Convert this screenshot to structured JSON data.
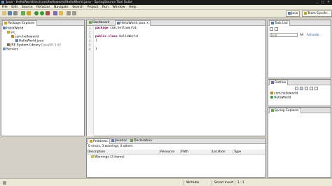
{
  "window": {
    "title": "Java - HelloWorld/src/com/helloworld/HelloWorld.java - SpringSource Tool Suite",
    "controls": [
      "_",
      "□",
      "✕"
    ]
  },
  "menu": [
    "File",
    "Edit",
    "Source",
    "Refactor",
    "Navigate",
    "Search",
    "Project",
    "Run",
    "Window",
    "Help"
  ],
  "perspectives": {
    "java": "Java",
    "team": "Team Synchr..."
  },
  "package_explorer": {
    "tab": "Package Explorer",
    "tree": [
      "HelloWorld",
      "src",
      "com.helloworld",
      "HelloWorld.java",
      "JRE System Library",
      "[JavaSE-1.6]",
      "Servers"
    ]
  },
  "editor": {
    "tabs": [
      "Dashboard",
      "HelloWorld.java"
    ],
    "line_numbers": [
      "1",
      "2",
      "3",
      "4",
      "5",
      "6"
    ],
    "lines": [
      {
        "kw": "package",
        "rest": " com.helloworld;"
      },
      {
        "kw": "",
        "rest": ""
      },
      {
        "kw": "public class",
        "rest": " HelloWorld"
      },
      {
        "kw": "",
        "rest": "{"
      },
      {
        "kw": "",
        "rest": ""
      },
      {
        "kw": "",
        "rest": "}"
      }
    ]
  },
  "task_list": {
    "tab": "Task List",
    "find_label": "Find",
    "all_label": "All",
    "activate_label": "Activate..."
  },
  "outline": {
    "tab": "Outline",
    "items": [
      "com.helloworld",
      "HelloWorld"
    ]
  },
  "spring_explorer": {
    "tab": "Spring Explorer"
  },
  "problems": {
    "tabs": [
      "Problems",
      "Javadoc",
      "Declaration"
    ],
    "summary": "0 errors, 3 warnings, 0 others",
    "columns": [
      "Description",
      "Resource",
      "Path",
      "Location",
      "Type"
    ],
    "rows": [
      {
        "description": "Warnings (3 items)"
      }
    ]
  },
  "status_bar": {
    "writable": "Writable",
    "insert_mode": "Smart Insert",
    "position": "1 : 1"
  },
  "colors": {
    "keyword": "#7f0055",
    "titlebar": "#1c1c1c",
    "chrome": "#ece9d8",
    "selection": "#c5d7ef"
  }
}
